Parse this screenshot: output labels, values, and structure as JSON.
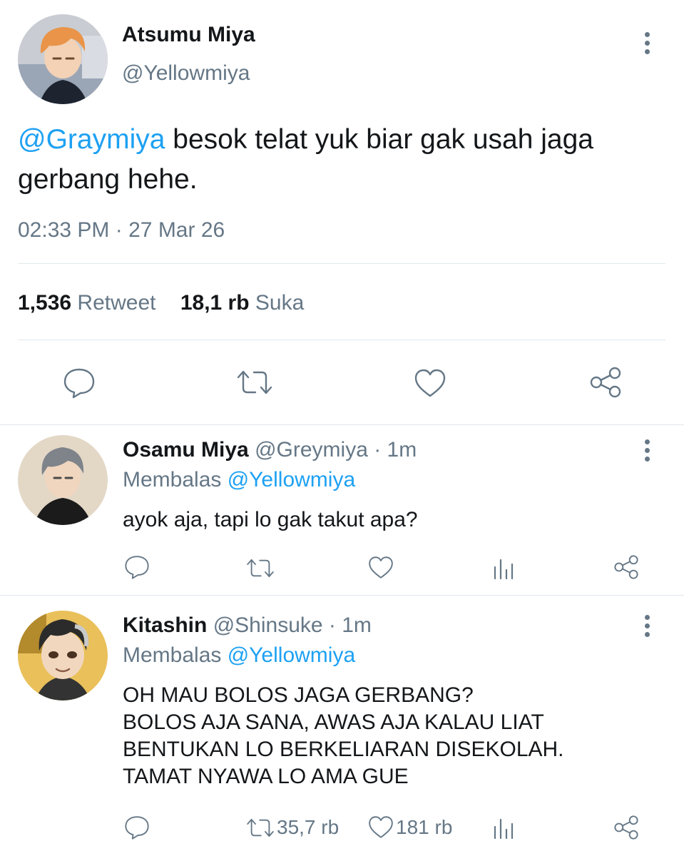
{
  "main_tweet": {
    "author_name": "Atsumu Miya",
    "author_handle": "@Yellowmiya",
    "mention": "@Graymiya",
    "text": " besok telat yuk biar gak usah jaga gerbang hehe.",
    "time": "02:33 PM",
    "separator": "·",
    "date": "27 Mar 26",
    "retweet_count": "1,536",
    "retweet_label": "Retweet",
    "like_count": "18,1 rb",
    "like_label": "Suka"
  },
  "replies": [
    {
      "author_name": "Osamu Miya",
      "author_handle": "@Greymiya",
      "age": "· 1m",
      "replying_prefix": "Membalas ",
      "replying_to": "@Yellowmiya",
      "text": "ayok aja, tapi lo gak takut apa?",
      "retweet_count": "",
      "like_count": ""
    },
    {
      "author_name": "Kitashin",
      "author_handle": "@Shinsuke",
      "age": "· 1m",
      "replying_prefix": "Membalas ",
      "replying_to": "@Yellowmiya",
      "text_lines": [
        "OH MAU BOLOS JAGA GERBANG?",
        "BOLOS AJA SANA, AWAS AJA KALAU LIAT",
        "BENTUKAN LO BERKELIARAN DISEKOLAH.",
        "TAMAT NYAWA LO AMA GUE"
      ],
      "retweet_count": "35,7 rb",
      "like_count": "181 rb"
    }
  ],
  "colors": {
    "link": "#1da1f2",
    "muted": "#657786",
    "divider": "#e1e8ed",
    "text": "#14171a"
  }
}
